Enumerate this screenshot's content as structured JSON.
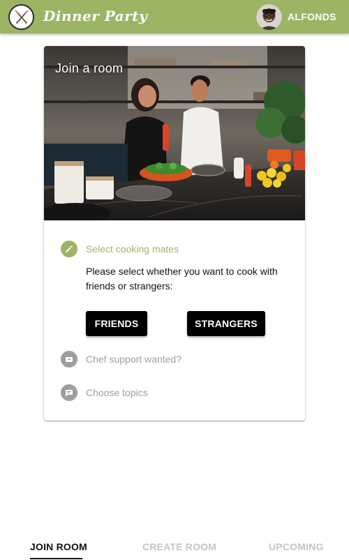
{
  "header": {
    "brand": "Dinner Party",
    "username": "ALFONDS",
    "logo_icon": "fork-knife-icon",
    "color": "#9bb565"
  },
  "card": {
    "hero_title": "Join a room",
    "steps": [
      {
        "label": "Select cooking mates",
        "icon": "pencil-icon",
        "state": "active"
      },
      {
        "label": "Chef support wanted?",
        "icon": "chef-icon",
        "state": "inactive"
      },
      {
        "label": "Choose topics",
        "icon": "chat-icon",
        "state": "inactive"
      }
    ],
    "description": "Please select whether you want to cook with friends or strangers:",
    "buttons": {
      "friends": "FRIENDS",
      "strangers": "STRANGERS"
    }
  },
  "bottom_nav": {
    "tabs": [
      {
        "label": "JOIN ROOM",
        "active": true
      },
      {
        "label": "CREATE ROOM",
        "active": false
      },
      {
        "label": "UPCOMING",
        "active": false
      }
    ]
  }
}
